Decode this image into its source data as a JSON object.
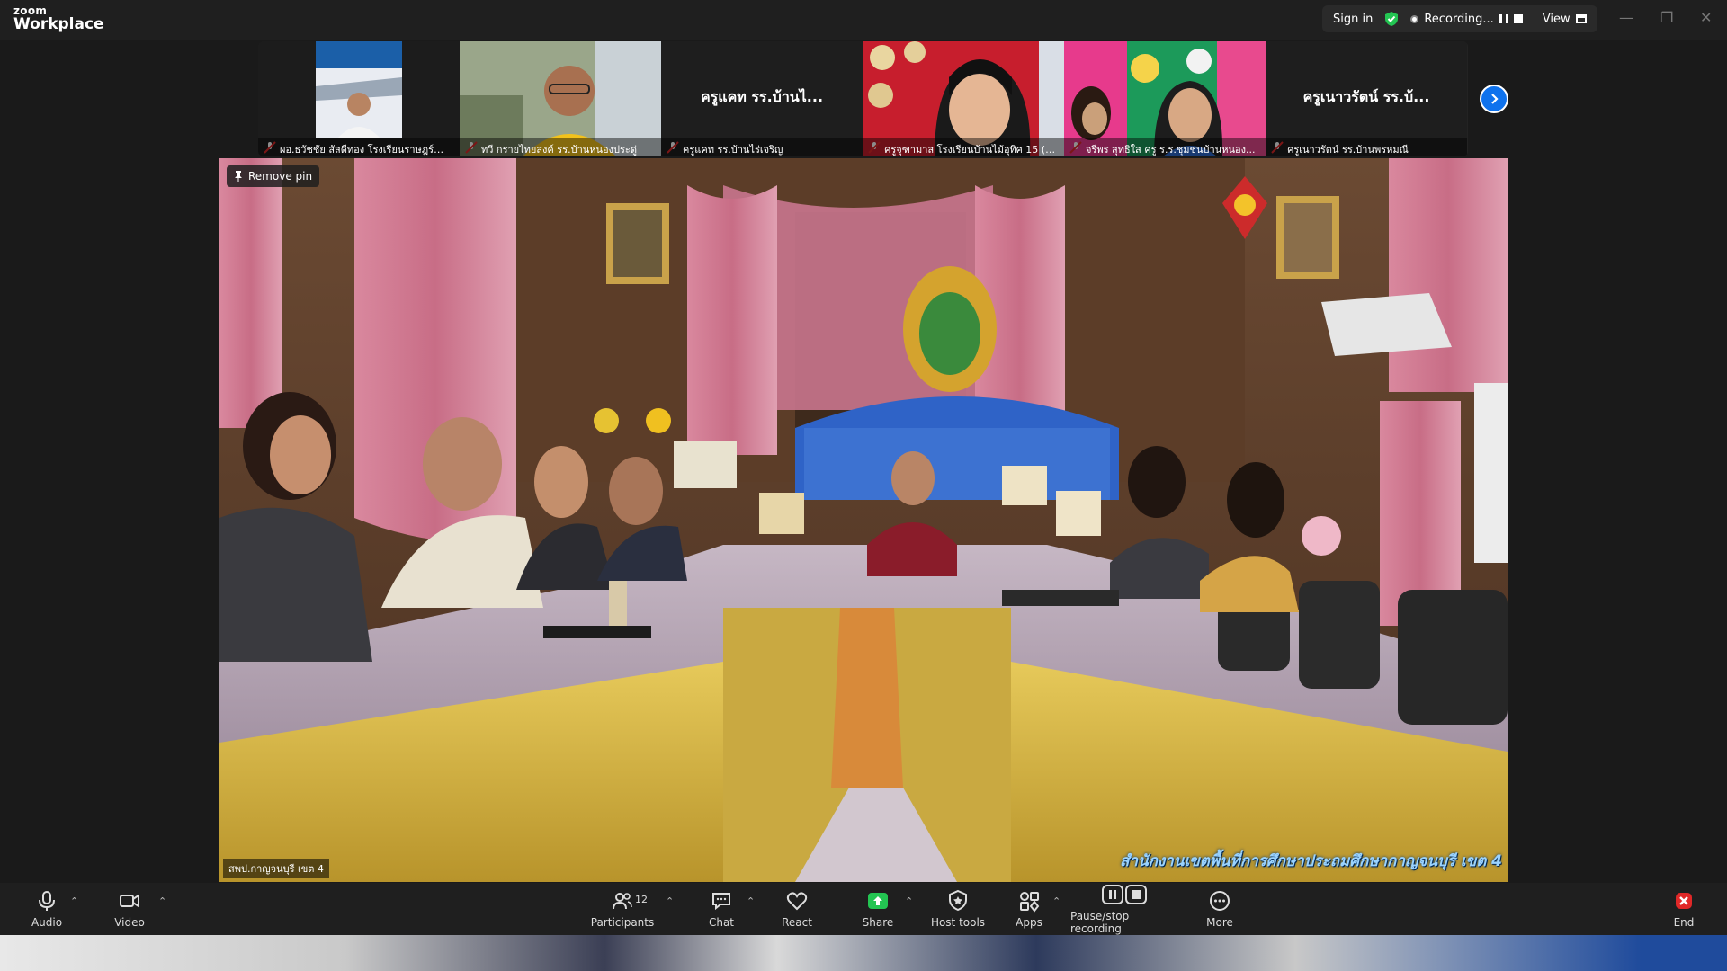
{
  "app": {
    "brand_small": "zoom",
    "brand_large": "Workplace"
  },
  "topbar": {
    "sign_in": "Sign in",
    "recording_label": "Recording...",
    "view_label": "View",
    "colors": {
      "shield": "#23c552",
      "bg": "#1f1f1f"
    }
  },
  "thumbnails": [
    {
      "name": "ผอ.ธวัชชัย สัสดีทอง โรงเรียนราษฎร์บำ...",
      "type": "video"
    },
    {
      "name": "ทวี กรายไทยสงค์ รร.บ้านหนองประดู่",
      "type": "video"
    },
    {
      "name": "ครูแคท รร.บ้านไร่เจริญ",
      "display_name": "ครูแคท รร.บ้านไ...",
      "type": "name"
    },
    {
      "name": "ครูจุฑามาส โรงเรียนบ้านไม้อุทิศ 15 (บ้า...",
      "type": "video"
    },
    {
      "name": "จรีพร สุทธิใส ครู ร.ร.ชุมชนบ้านหนอง...",
      "type": "video"
    },
    {
      "name": "ครูเนาวรัตน์ รร.บ้านพรหมณี",
      "display_name": "ครูเนาวรัตน์ รร.บ้...",
      "type": "name"
    }
  ],
  "main_video": {
    "remove_pin": "Remove pin",
    "speaker_name": "สพป.กาญจนบุรี เขต 4",
    "caption": "สำนักงานเขตพื้นที่การศึกษาประถมศึกษากาญจนบุรี เขต 4"
  },
  "toolbar": {
    "audio": "Audio",
    "video": "Video",
    "participants": "Participants",
    "participants_count": "12",
    "chat": "Chat",
    "react": "React",
    "share": "Share",
    "host_tools": "Host tools",
    "apps": "Apps",
    "pause_stop_recording": "Pause/stop recording",
    "more": "More",
    "end": "End",
    "colors": {
      "share": "#23c552",
      "end": "#e02828"
    }
  }
}
